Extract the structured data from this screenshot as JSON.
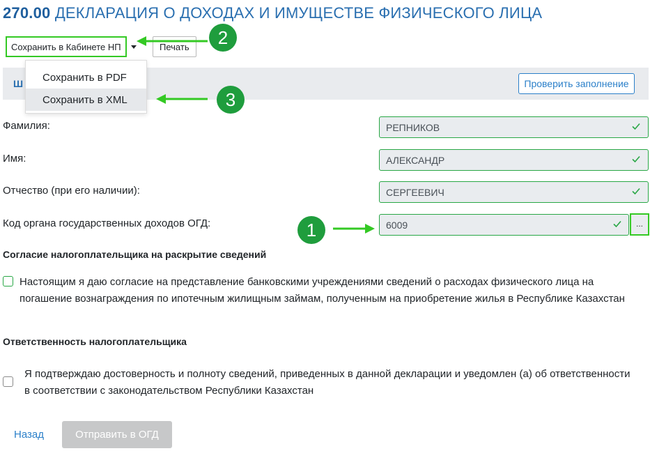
{
  "page": {
    "code": "270.00",
    "title": "ДЕКЛАРАЦИЯ О ДОХОДАХ И ИМУЩЕСТВЕ ФИЗИЧЕСКОГО ЛИЦА"
  },
  "toolbar": {
    "save_label": "Сохранить в Кабинете НП",
    "print_label": "Печать",
    "save_menu": {
      "pdf_label": "Сохранить в PDF",
      "xml_label": "Сохранить в XML"
    },
    "tab_label": "Ш",
    "check_label": "Проверить заполнение"
  },
  "form": {
    "surname": {
      "label": "Фамилия:",
      "value": "РЕПНИКОВ"
    },
    "name": {
      "label": "Имя:",
      "value": "АЛЕКСАНДР"
    },
    "patronymic": {
      "label": "Отчество (при его наличии):",
      "value": "СЕРГЕЕВИЧ"
    },
    "ogd_code": {
      "label": "Код органа государственных доходов ОГД:",
      "value": "6009",
      "picker_label": "..."
    }
  },
  "consent": {
    "heading": "Согласие налогоплательщика на раскрытие сведений",
    "text": "Настоящим я даю согласие на представление банковскими учреждениями сведений о расходах физического лица на погашение вознаграждения по ипотечным жилищным займам, полученным на приобретение жилья в Республике Казахстан"
  },
  "responsibility": {
    "heading": "Ответственность налогоплательщика",
    "text": "Я подтверждаю достоверность и полноту сведений, приведенных в данной декларации и уведомлен (а) об ответственности в соответствии с законодательством Республики Казахстан"
  },
  "footer": {
    "back_label": "Назад",
    "send_label": "Отправить в ОГД"
  },
  "callouts": {
    "one": "1",
    "two": "2",
    "three": "3"
  },
  "colors": {
    "accent_blue": "#2a6fb0",
    "valid_green": "#28a745",
    "highlight_green": "#34c924",
    "callout_green": "#1f9d3d"
  }
}
